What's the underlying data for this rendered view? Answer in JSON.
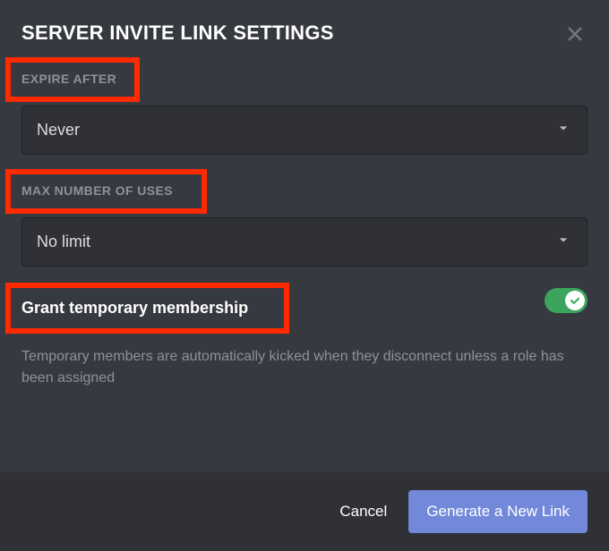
{
  "header": {
    "title": "SERVER INVITE LINK SETTINGS"
  },
  "expire": {
    "label": "EXPIRE AFTER",
    "value": "Never"
  },
  "maxUses": {
    "label": "MAX NUMBER OF USES",
    "value": "No limit"
  },
  "grant": {
    "label": "Grant temporary membership",
    "description": "Temporary members are automatically kicked when they disconnect unless a role has been assigned"
  },
  "footer": {
    "cancel": "Cancel",
    "generate": "Generate a New Link"
  }
}
